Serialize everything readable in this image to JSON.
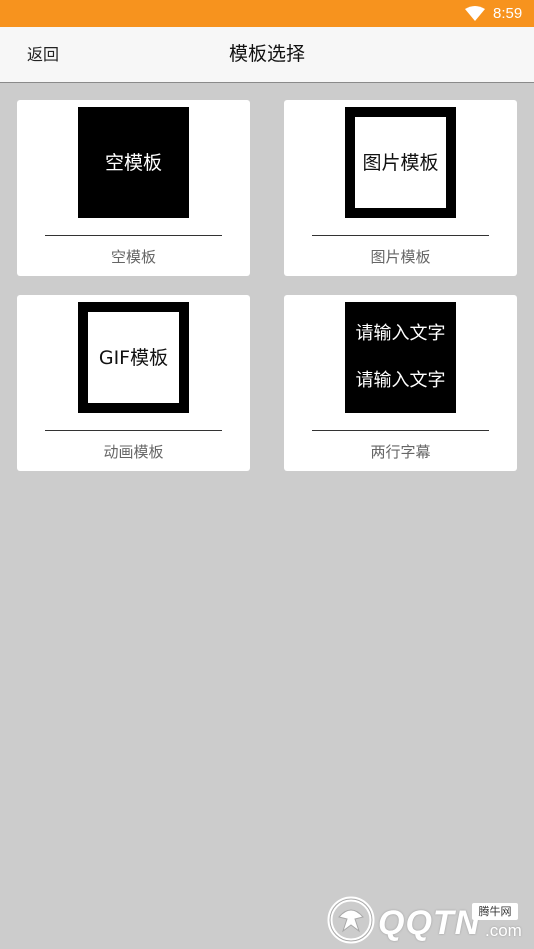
{
  "status_bar": {
    "time": "8:59",
    "background": "#f7931e"
  },
  "header": {
    "back_label": "返回",
    "title": "模板选择"
  },
  "templates": [
    {
      "thumb_text": "空模板",
      "label": "空模板",
      "style": "solid"
    },
    {
      "thumb_text": "图片模板",
      "label": "图片模板",
      "style": "framed"
    },
    {
      "thumb_text": "GIF模板",
      "label": "动画模板",
      "style": "framed"
    },
    {
      "thumb_lines": [
        "请输入文字",
        "请输入文字"
      ],
      "label": "两行字幕",
      "style": "two-line"
    }
  ],
  "watermark": {
    "brand": "QQTN",
    "suffix": ".com",
    "badge": "腾牛网"
  }
}
